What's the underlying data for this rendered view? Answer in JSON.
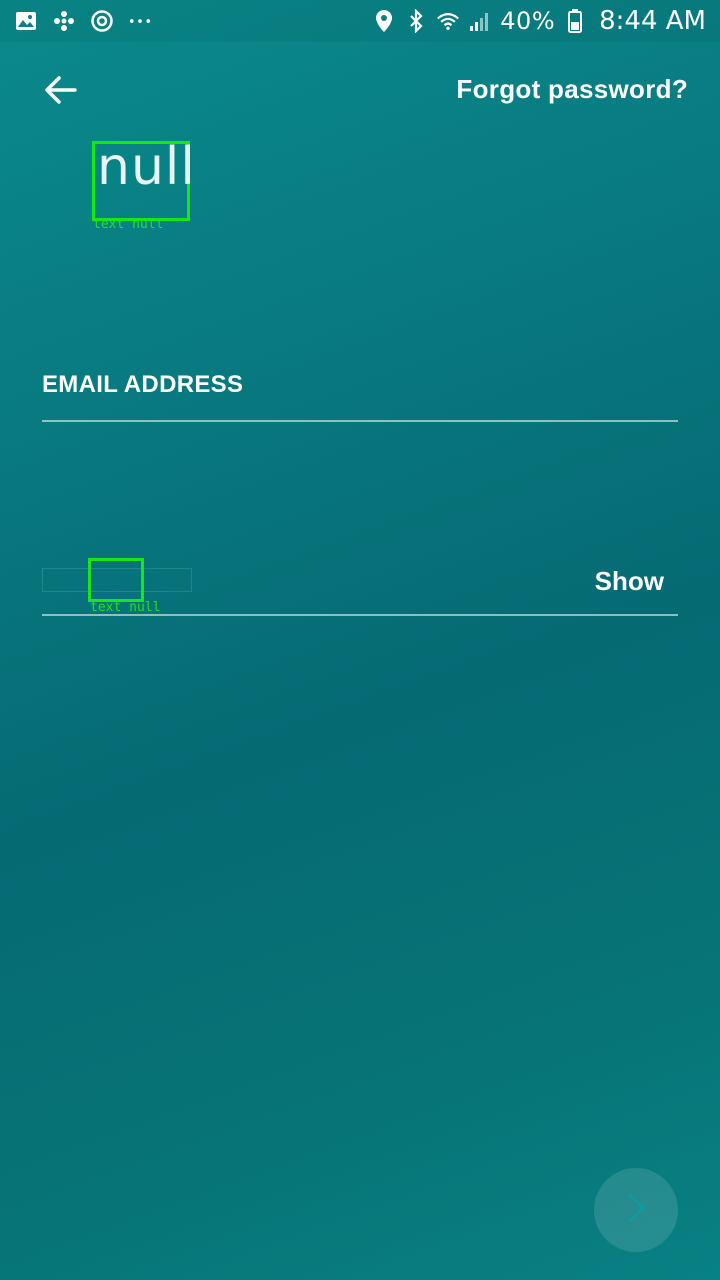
{
  "status_bar": {
    "left_icons": [
      "gallery-icon",
      "pinwheel-icon",
      "sync-icon",
      "more-dots-icon"
    ],
    "battery_percent": "40%",
    "time": "8:44 AM"
  },
  "header": {
    "back_icon": "arrow-left-icon",
    "forgot_password": "Forgot password?"
  },
  "logo": {
    "text": "null",
    "debug_label": "text null"
  },
  "form": {
    "email_label": "EMAIL ADDRESS",
    "email_value": "",
    "password_value": "",
    "password_debug_label": "text null",
    "show_label": "Show"
  },
  "next_button": {
    "icon": "chevron-right-icon"
  }
}
